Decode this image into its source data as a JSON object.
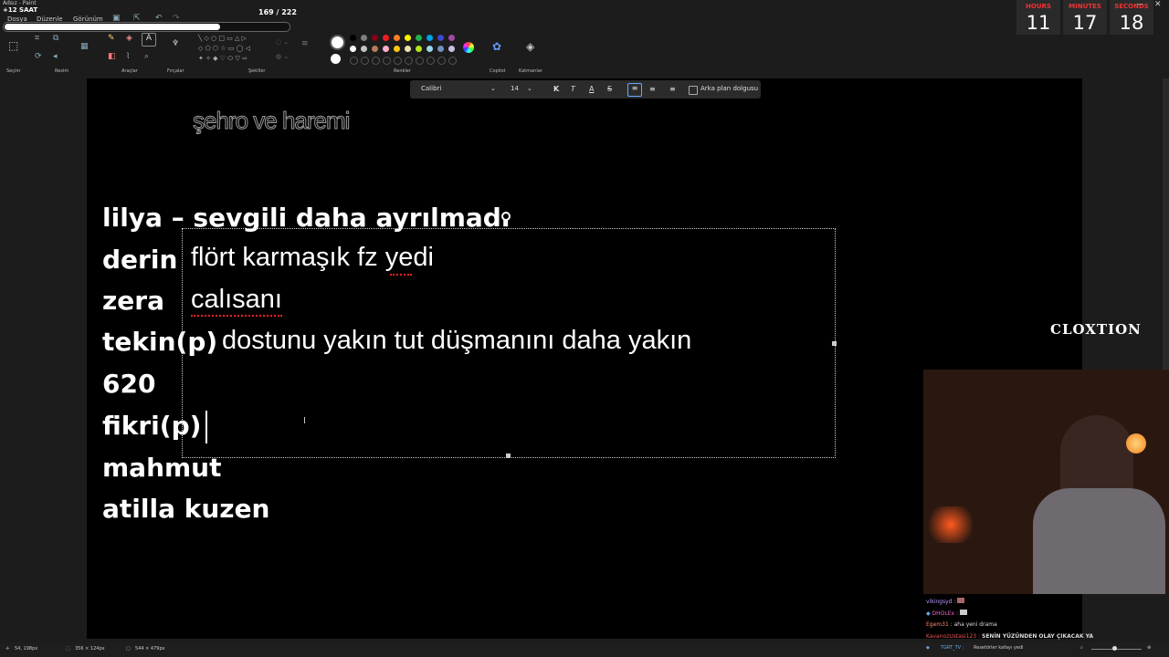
{
  "window": {
    "title": "Adsız - Paint"
  },
  "stream": {
    "plus_hours": "+12 SAAT",
    "sub_count": "169 / 222",
    "progress": 0.76
  },
  "menu": {
    "items": [
      "Dosya",
      "Düzenle",
      "Görünüm"
    ]
  },
  "ribbon": {
    "groups": [
      "Seçim",
      "Resim",
      "Araçlar",
      "Fırçalar",
      "Şekiller",
      "Renkler",
      "Copilot",
      "Katmanlar"
    ]
  },
  "timer": {
    "labels": [
      "HOURS",
      "MINUTES",
      "SECONDS"
    ],
    "values": [
      "11",
      "17",
      "18"
    ]
  },
  "format_bar": {
    "font": "Calibri",
    "size": "14",
    "bold": "K",
    "italic": "T",
    "underline": "A",
    "strike": "S",
    "background_fill": "Arka plan dolgusu"
  },
  "canvas": {
    "faded_title": "şehro ve haremi",
    "lines": [
      {
        "name": "lilya – sevgili daha ayrılmadı",
        "note": ""
      },
      {
        "name": "derin",
        "note": "flört karmaşık fz yedi"
      },
      {
        "name": "zera",
        "note": "calısanı"
      },
      {
        "name": "tekin(p)",
        "note": "dostunu yakın tut düşmanını daha yakın"
      },
      {
        "name": "620",
        "note": ""
      },
      {
        "name": "fikri(p)",
        "note": ""
      },
      {
        "name": "mahmut",
        "note": ""
      },
      {
        "name": "atilla kuzen",
        "note": ""
      }
    ]
  },
  "watermark": "CLOXTION",
  "chat": [
    {
      "user": "vikingsyd :",
      "msg": ""
    },
    {
      "user": "DHOLEx :",
      "msg": ""
    },
    {
      "user": "Egem31 :",
      "msg": "aha yeni drama"
    },
    {
      "user": "KavanozUstasi123 :",
      "msg": "SENİN YÜZÜNDEN OLAY ÇIKACAK YA"
    },
    {
      "user": "TGRT_TV :",
      "msg": "Resetörler kafayı yedi"
    }
  ],
  "status": {
    "cursor": "54, 198px",
    "selection": "356 × 124px",
    "canvas_size": "544 × 479px"
  }
}
